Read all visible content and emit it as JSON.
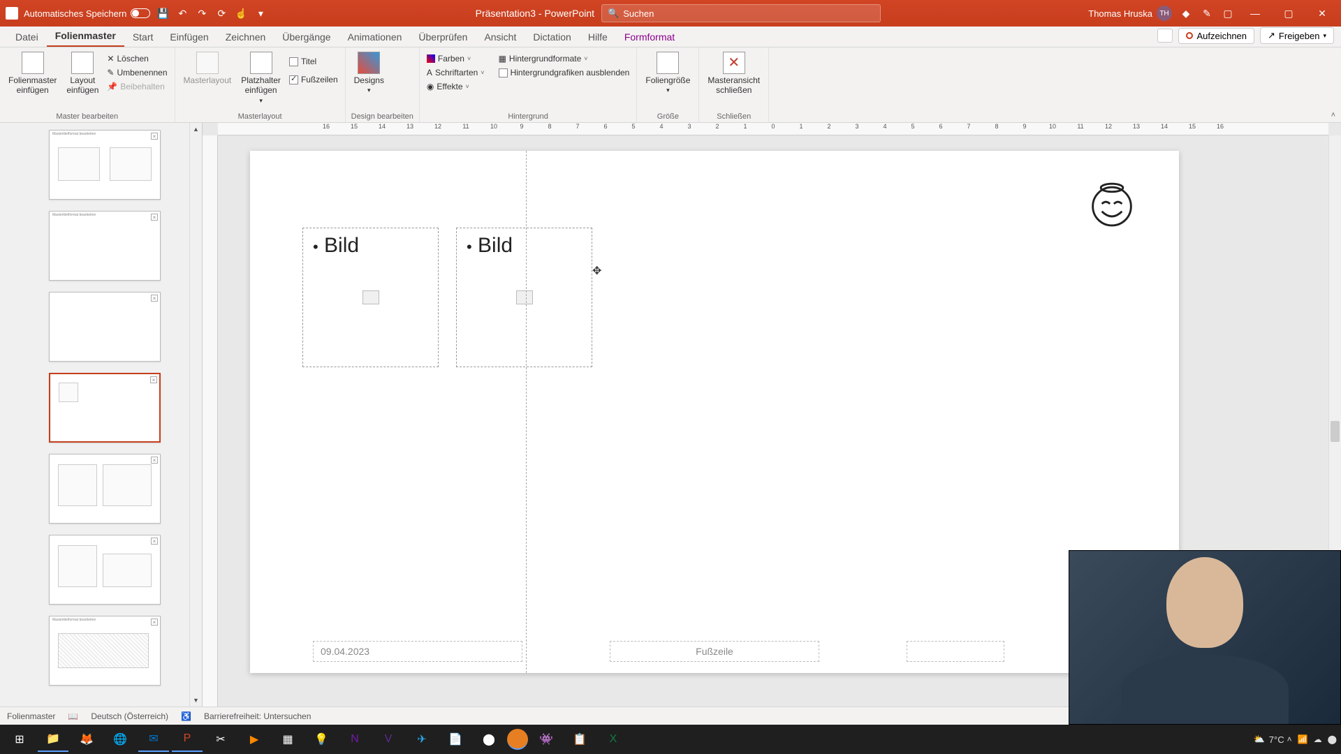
{
  "titlebar": {
    "autosave_label": "Automatisches Speichern",
    "doc_title": "Präsentation3 - PowerPoint",
    "search_placeholder": "Suchen",
    "user_name": "Thomas Hruska",
    "user_initials": "TH"
  },
  "tabs": {
    "datei": "Datei",
    "folienmaster": "Folienmaster",
    "start": "Start",
    "einfuegen": "Einfügen",
    "zeichnen": "Zeichnen",
    "uebergaenge": "Übergänge",
    "animationen": "Animationen",
    "ueberpruefen": "Überprüfen",
    "ansicht": "Ansicht",
    "dictation": "Dictation",
    "hilfe": "Hilfe",
    "formformat": "Formformat",
    "aufzeichnen": "Aufzeichnen",
    "freigeben": "Freigeben"
  },
  "ribbon": {
    "master_bearbeiten": {
      "folienmaster_einfuegen": "Folienmaster\neinfügen",
      "layout_einfuegen": "Layout\neinfügen",
      "loeschen": "Löschen",
      "umbenennen": "Umbenennen",
      "beibehalten": "Beibehalten",
      "label": "Master bearbeiten"
    },
    "masterlayout": {
      "masterlayout": "Masterlayout",
      "platzhalter_einfuegen": "Platzhalter\neinfügen",
      "titel": "Titel",
      "fusszeilen": "Fußzeilen",
      "label": "Masterlayout"
    },
    "design": {
      "designs": "Designs",
      "farben": "Farben",
      "schriftarten": "Schriftarten",
      "effekte": "Effekte",
      "label": "Design bearbeiten"
    },
    "hintergrund": {
      "hintergrundformate": "Hintergrundformate",
      "grafiken_ausblenden": "Hintergrundgrafiken ausblenden",
      "label": "Hintergrund"
    },
    "groesse": {
      "foliengroesse": "Foliengröße",
      "label": "Größe"
    },
    "schliessen": {
      "masteransicht_schliessen": "Masteransicht\nschließen",
      "label": "Schließen"
    }
  },
  "ruler": [
    "16",
    "15",
    "14",
    "13",
    "12",
    "11",
    "10",
    "9",
    "8",
    "7",
    "6",
    "5",
    "4",
    "3",
    "2",
    "1",
    "0",
    "1",
    "2",
    "3",
    "4",
    "5",
    "6",
    "7",
    "8",
    "9",
    "10",
    "11",
    "12",
    "13",
    "14",
    "15",
    "16"
  ],
  "slide": {
    "ph1_text": "Bild",
    "ph2_text": "Bild",
    "date": "09.04.2023",
    "footer": "Fußzeile"
  },
  "status": {
    "view": "Folienmaster",
    "lang": "Deutsch (Österreich)",
    "a11y": "Barrierefreiheit: Untersuchen"
  },
  "taskbar": {
    "temp": "7°C"
  },
  "thumbs": {
    "mini_title": "Mastertitelformat bearbeiten"
  }
}
